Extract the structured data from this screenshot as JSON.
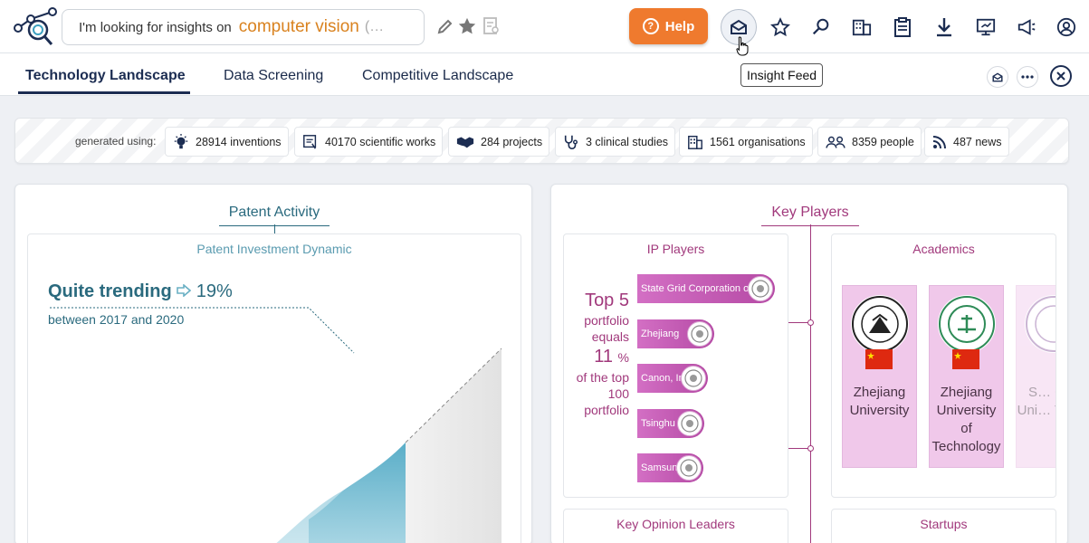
{
  "header": {
    "search_prefix": "I'm looking for insights on",
    "search_topic": "computer vision",
    "search_ellipsis": "(…",
    "help_label": "Help",
    "tooltip": "Insight Feed"
  },
  "tabs": [
    {
      "label": "Technology Landscape",
      "active": true
    },
    {
      "label": "Data Screening",
      "active": false
    },
    {
      "label": "Competitive Landscape",
      "active": false
    }
  ],
  "sources": {
    "label": "generated using:",
    "chips": [
      {
        "icon": "lightbulb-icon",
        "text": "28914 inventions"
      },
      {
        "icon": "document-icon",
        "text": "40170 scientific works"
      },
      {
        "icon": "handshake-icon",
        "text": "284 projects"
      },
      {
        "icon": "stethoscope-icon",
        "text": "3 clinical studies"
      },
      {
        "icon": "building-icon",
        "text": "1561 organisations"
      },
      {
        "icon": "people-icon",
        "text": "8359 people"
      },
      {
        "icon": "rss-icon",
        "text": "487 news"
      }
    ]
  },
  "patent_activity": {
    "title": "Patent Activity",
    "card_title": "Patent Investment Dynamic",
    "trend_label": "Quite trending",
    "trend_pct": "19%",
    "trend_period": "between 2017 and 2020"
  },
  "key_players": {
    "title": "Key Players",
    "ip_players": {
      "title": "IP Players",
      "stat_line1": "Top 5",
      "stat_line2": "portfolio",
      "stat_line3": "equals",
      "stat_value": "11",
      "stat_unit": "%",
      "stat_line4": "of the top",
      "stat_line5": "100",
      "stat_line6": "portfolio",
      "bars": [
        {
          "name": "State Grid Corporation o",
          "share": 1.0
        },
        {
          "name": "Zhejiang",
          "share": 0.56
        },
        {
          "name": "Canon, Inc",
          "share": 0.51
        },
        {
          "name": "Tsinghu",
          "share": 0.49
        },
        {
          "name": "Samsun",
          "share": 0.48
        }
      ]
    },
    "academics": {
      "title": "Academics",
      "items": [
        {
          "name": "Zhejiang University"
        },
        {
          "name": "Zhejiang University of Technology"
        },
        {
          "name": "S… C… Uni… Tec…"
        }
      ]
    },
    "kol_title": "Key Opinion Leaders",
    "startups_title": "Startups"
  },
  "colors": {
    "accent_orange": "#ef7a2e",
    "topic_orange": "#d9821f",
    "navy": "#1c2d52",
    "teal": "#2a6a7e",
    "purple": "#a1397c"
  }
}
